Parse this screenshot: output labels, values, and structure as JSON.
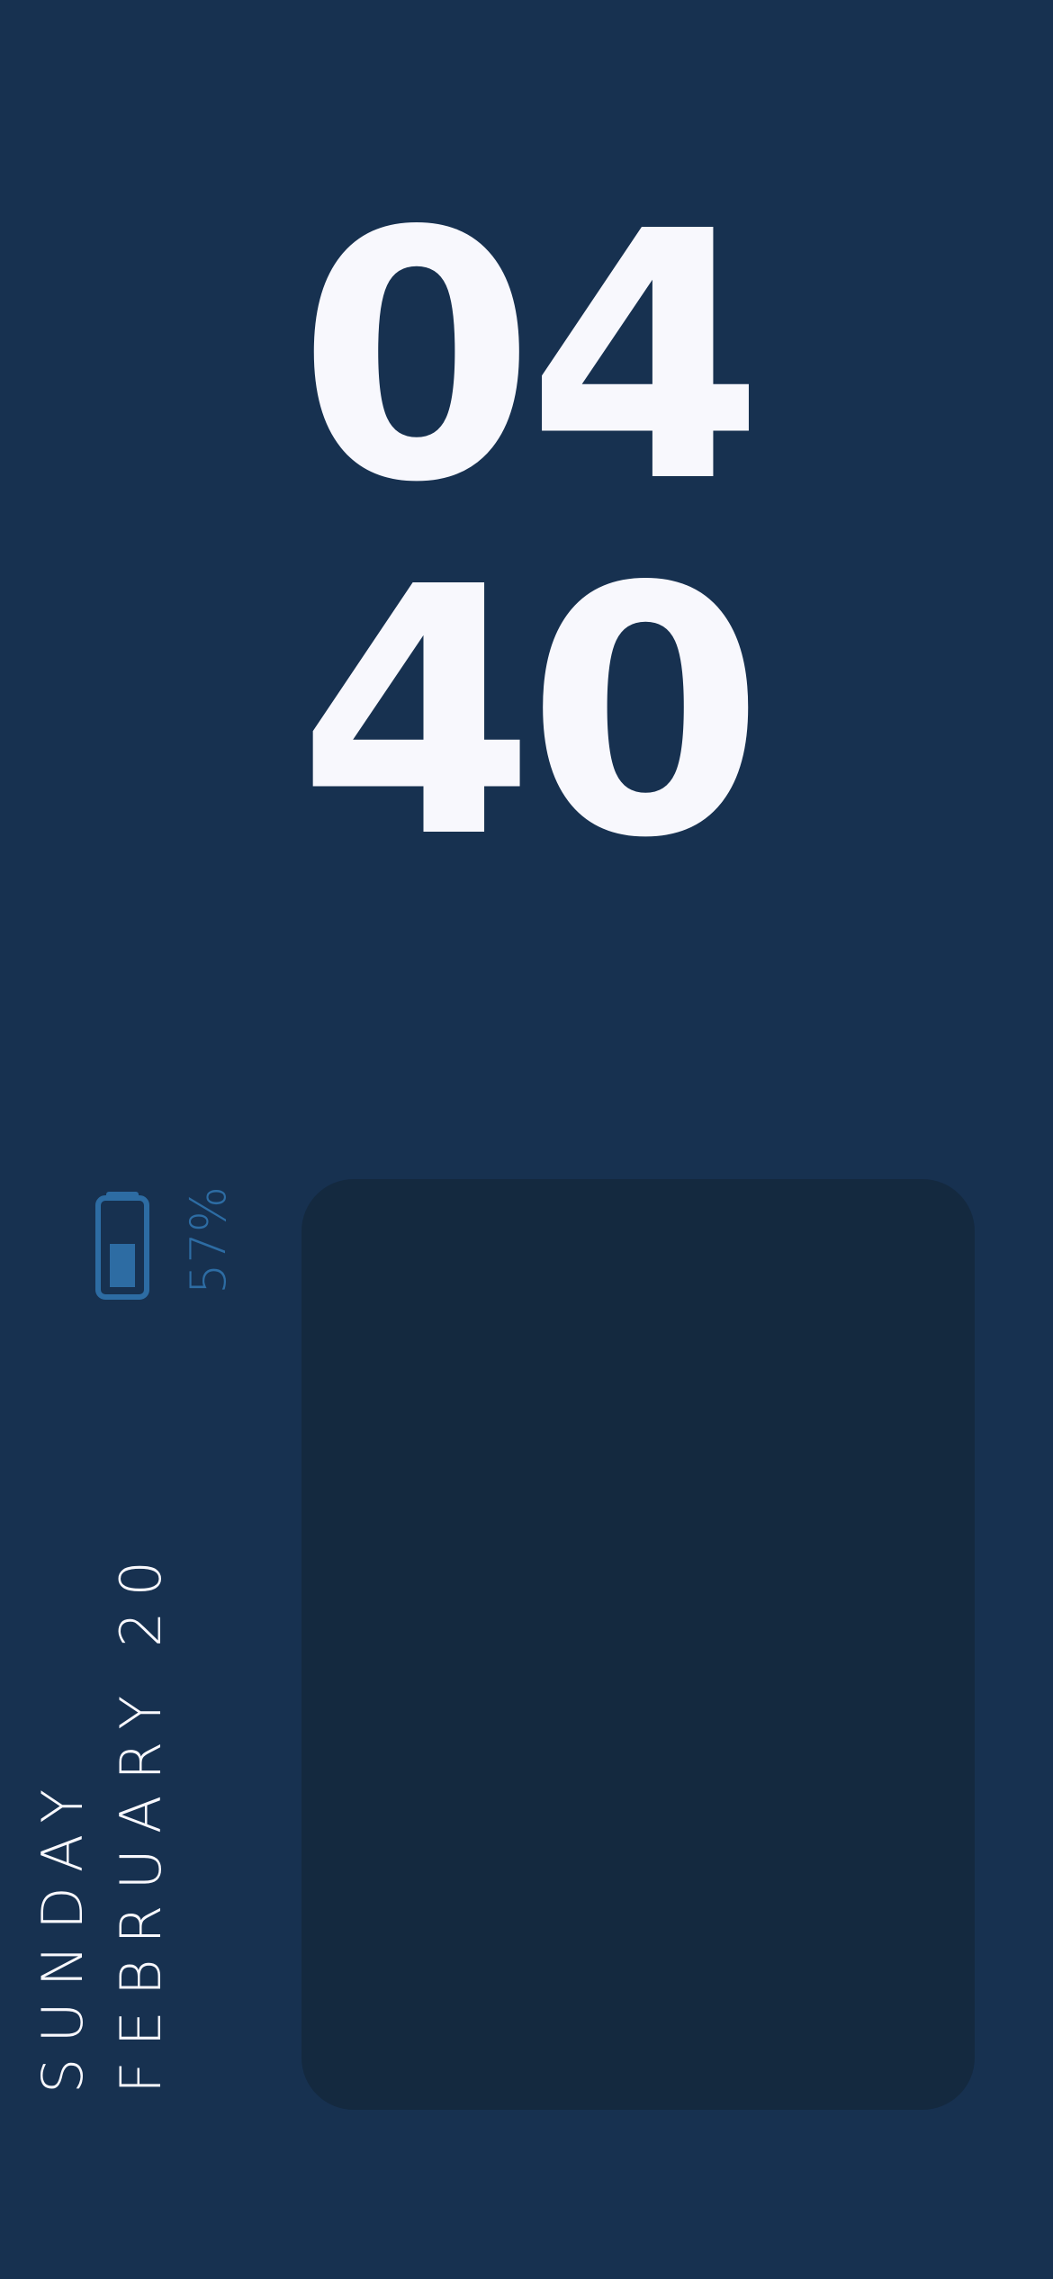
{
  "clock": {
    "hours": "04",
    "minutes": "40"
  },
  "battery": {
    "percent_label": "57%",
    "level": 0.57,
    "icon": "battery-icon"
  },
  "date": {
    "weekday": "SUNDAY",
    "month_day": "FEBRUARY 20"
  },
  "colors": {
    "background": "#173150",
    "clock_text": "#f8f8fd",
    "battery_accent": "#2d6ca3",
    "widget_panel": "#14293f"
  }
}
